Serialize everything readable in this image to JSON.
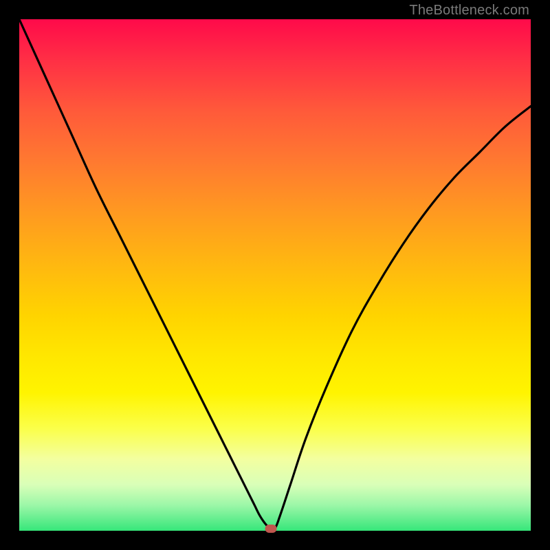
{
  "watermark": "TheBottleneck.com",
  "colors": {
    "frame": "#000000",
    "curve": "#000000",
    "marker": "#c0574e"
  },
  "chart_data": {
    "type": "line",
    "title": "",
    "xlabel": "",
    "ylabel": "",
    "xlim": [
      0,
      100
    ],
    "ylim": [
      0,
      100
    ],
    "grid": false,
    "series": [
      {
        "name": "bottleneck-curve",
        "x": [
          0,
          5,
          10,
          15,
          20,
          25,
          30,
          33,
          36,
          39,
          41,
          43,
          45,
          46,
          47,
          48,
          49,
          50,
          51,
          53,
          56,
          60,
          65,
          70,
          75,
          80,
          85,
          90,
          95,
          100
        ],
        "values": [
          100,
          89,
          78,
          67,
          57,
          47,
          37,
          31,
          25,
          19,
          15,
          11,
          7,
          5,
          3,
          1.5,
          0.5,
          0.5,
          3,
          9,
          18,
          28,
          39,
          48,
          56,
          63,
          69,
          74,
          79,
          83
        ]
      }
    ],
    "annotations": [
      {
        "name": "optimal-marker",
        "x": 49.2,
        "y": 0.4,
        "shape": "rounded-rect",
        "color": "#c0574e"
      }
    ],
    "background_gradient": {
      "direction": "vertical",
      "stops": [
        {
          "pos": 0.0,
          "color": "#ff0a4a"
        },
        {
          "pos": 0.58,
          "color": "#ffd400"
        },
        {
          "pos": 0.86,
          "color": "#f3ffa0"
        },
        {
          "pos": 1.0,
          "color": "#36e67a"
        }
      ]
    }
  }
}
